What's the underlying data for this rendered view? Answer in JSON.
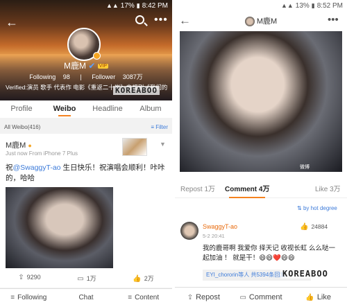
{
  "left": {
    "status": {
      "battery": "17%",
      "time": "8:42 PM"
    },
    "profile": {
      "name": "M鹿M",
      "vip_badge": "VIP",
      "following_label": "Following",
      "following_count": "98",
      "follower_label": "Follower",
      "follower_count": "3087万",
      "verified_text": "Verified:演员 歌手 代表作 电影《重返二十岁》电视剧《我们的"
    },
    "watermark": "KOREABOO",
    "tabs": [
      "Profile",
      "Weibo",
      "Headline",
      "Album"
    ],
    "filter": {
      "all_label": "All Weibo(416)",
      "filter_label": "Filter"
    },
    "post": {
      "author": "M鹿M",
      "meta": "Just now   From iPhone 7 Plus",
      "text_prefix": "祝",
      "mention": "@SwaggyT-ao",
      "text_rest": " 生日快乐！祝演唱会顺利！咔咔的，哈哈",
      "reposts": "9290",
      "comments": "1万",
      "likes": "2万"
    },
    "bottom_bar": [
      "Following",
      "Chat",
      "Content"
    ]
  },
  "right": {
    "status": {
      "battery": "13%",
      "time": "8:52 PM"
    },
    "title": "M鹿M",
    "photo_watermark": "微博",
    "tabs": {
      "repost": "Repost 1万",
      "comment": "Comment 4万",
      "like": "Like 3万"
    },
    "sort_label": "by hot degree",
    "comment": {
      "author": "SwaggyT-ao",
      "likes": "24884",
      "time": "5-2 20:41",
      "text": "我的鹿哥啊 我爱你  择天记 收视长虹 么么哒一起加油 ！ 就是干！😄😄❤️😄😄",
      "reply_user": "EYI_chororin等人",
      "reply_count": "共5394条回复"
    },
    "watermark": "KOREABOO",
    "bottom_bar": [
      "Repost",
      "Comment",
      "Like"
    ]
  }
}
